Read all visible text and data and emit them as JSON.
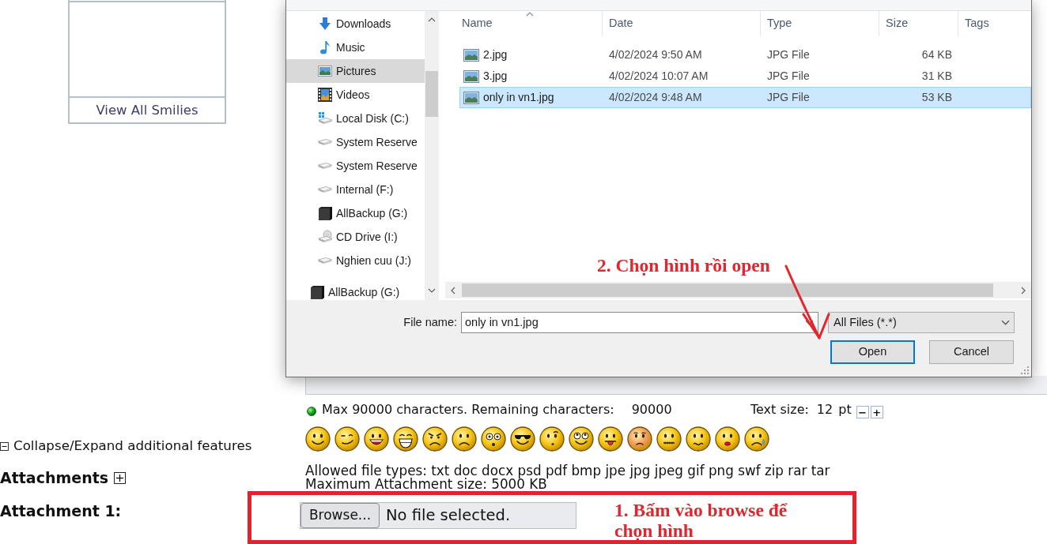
{
  "smilies_panel": {
    "link": "View All Smilies"
  },
  "file_dialog": {
    "nav": [
      {
        "children": [
          {
            "label": "Downloads",
            "kind": "downloads",
            "selected": false
          },
          {
            "label": "Music",
            "kind": "music",
            "selected": false
          },
          {
            "label": "Pictures",
            "kind": "pictures",
            "selected": true
          },
          {
            "label": "Videos",
            "kind": "videos",
            "selected": false
          },
          {
            "label": "Local Disk (C:)",
            "kind": "system_drive",
            "selected": false
          },
          {
            "label": "System Reserve",
            "kind": "drive",
            "selected": false
          },
          {
            "label": "System Reserve",
            "kind": "drive",
            "selected": false
          },
          {
            "label": "Internal (F:)",
            "kind": "drive",
            "selected": false
          },
          {
            "label": "AllBackup (G:)",
            "kind": "box_drive",
            "selected": false
          },
          {
            "label": "CD Drive (I:)",
            "kind": "disc_drive",
            "selected": false
          },
          {
            "label": "Nghien cuu (J:)",
            "kind": "drive",
            "selected": false
          }
        ]
      },
      {
        "label": "AllBackup (G:)",
        "kind": "box_drive",
        "selected": false
      }
    ],
    "columns": [
      {
        "label": "Name",
        "sorted": true
      },
      {
        "label": "Date",
        "sorted": false
      },
      {
        "label": "Type",
        "sorted": false
      },
      {
        "label": "Size",
        "sorted": false
      },
      {
        "label": "Tags",
        "sorted": false
      }
    ],
    "files": [
      {
        "name": "2.jpg",
        "date": "4/02/2024 9:50 AM",
        "type": "JPG File",
        "size": "64 KB",
        "selected": false
      },
      {
        "name": "3.jpg",
        "date": "4/02/2024 10:07 AM",
        "type": "JPG File",
        "size": "31 KB",
        "selected": false
      },
      {
        "name": "only in vn1.jpg",
        "date": "4/02/2024 9:48 AM",
        "type": "JPG File",
        "size": "53 KB",
        "selected": true
      }
    ],
    "file_name": {
      "label": "File name:",
      "value": "only in vn1.jpg"
    },
    "file_type_filter": "All Files (*.*)",
    "buttons": [
      {
        "label": "Open",
        "default": true
      },
      {
        "label": "Cancel",
        "default": false
      }
    ]
  },
  "open_hint": "2. Chọn hình rồi open",
  "editor": {
    "counter_label": "Max 90000 characters. Remaining characters:",
    "remaining": "90000",
    "text_size_label": "Text size:",
    "text_size": "12",
    "text_size_unit": "pt",
    "size_buttons": [
      "−",
      "+"
    ]
  },
  "smilies": [
    {
      "kind": "smile"
    },
    {
      "kind": "wink"
    },
    {
      "kind": "grin"
    },
    {
      "kind": "laugh"
    },
    {
      "kind": "angry"
    },
    {
      "kind": "frown"
    },
    {
      "kind": "shocked"
    },
    {
      "kind": "sunglasses"
    },
    {
      "kind": "puzzled"
    },
    {
      "kind": "wide_eyed"
    },
    {
      "kind": "tongue"
    },
    {
      "kind": "blushing"
    },
    {
      "kind": "zipped"
    },
    {
      "kind": "worried"
    },
    {
      "kind": "lips"
    },
    {
      "kind": "crying"
    }
  ],
  "additional_features": {
    "label": "Collapse/Expand additional features",
    "expanded": true
  },
  "attachments": {
    "title": "Attachments",
    "expanded": false,
    "allowed_types": "Allowed file types: txt doc docx psd pdf bmp jpe jpg jpeg gif png swf zip rar tar",
    "max_size": "Maximum Attachment size: 5000 KB",
    "fields": [
      {
        "label": "Attachment 1:",
        "button": "Browse...",
        "status": "No file selected."
      }
    ]
  },
  "browse_hint": "1. Bấm vào browse để chọn hình"
}
